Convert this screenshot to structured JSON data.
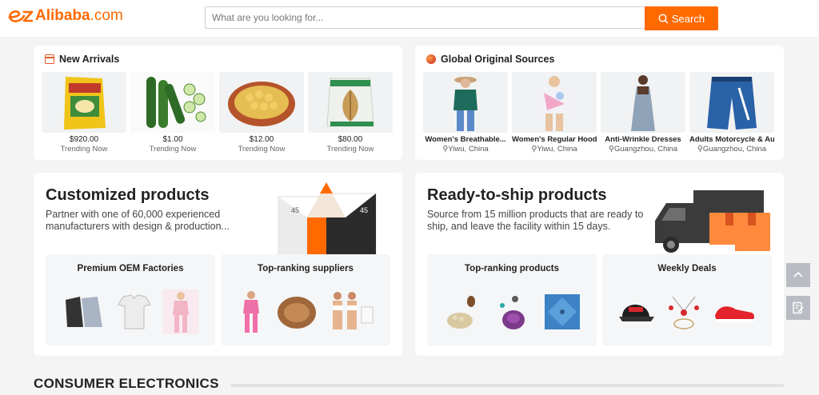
{
  "brand": {
    "mark": "e",
    "name": "Alibaba",
    "suffix": ".com",
    "color": "#ff6a00"
  },
  "search": {
    "placeholder": "What are you looking for...",
    "button_label": "Search",
    "icon": "search-icon"
  },
  "new_arrivals": {
    "title": "New Arrivals",
    "icon": "calendar-icon",
    "items": [
      {
        "price": "$920.00",
        "sub": "Trending Now"
      },
      {
        "price": "$1.00",
        "sub": "Trending Now"
      },
      {
        "price": "$12.00",
        "sub": "Trending Now"
      },
      {
        "price": "$80.00",
        "sub": "Trending Now"
      }
    ]
  },
  "global_sources": {
    "title": "Global Original Sources",
    "icon": "globe-icon",
    "items": [
      {
        "name": "Women's Breathable...",
        "location": "Yiwu, China"
      },
      {
        "name": "Women's Regular Hoodies",
        "location": "Yiwu, China"
      },
      {
        "name": "Anti-Wrinkle Dresses",
        "location": "Guangzhou, China"
      },
      {
        "name": "Adults Motorcycle & Auto...",
        "location": "Guangzhou, China"
      }
    ]
  },
  "customized": {
    "title": "Customized products",
    "description": "Partner with one of 60,000 experienced manufacturers with design & production...",
    "badges": [
      "45",
      "45"
    ],
    "subcards": [
      {
        "title": "Premium OEM Factories"
      },
      {
        "title": "Top-ranking suppliers"
      }
    ]
  },
  "ready": {
    "title": "Ready-to-ship products",
    "description": "Source from 15 million products that are ready to ship, and leave the facility within 15 days.",
    "subcards": [
      {
        "title": "Top-ranking products"
      },
      {
        "title": "Weekly Deals"
      }
    ]
  },
  "section": {
    "title": "CONSUMER ELECTRONICS"
  },
  "side_buttons": [
    "back-to-top-icon",
    "feedback-icon"
  ]
}
